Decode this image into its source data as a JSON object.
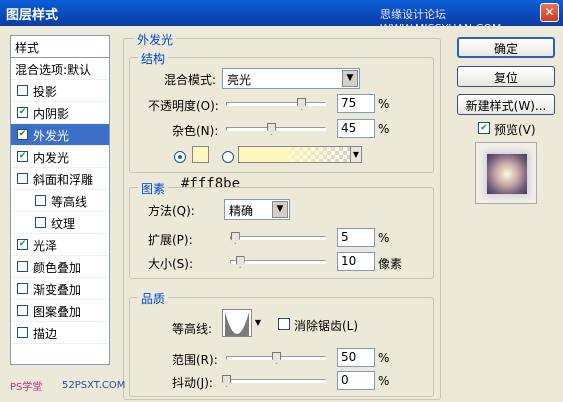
{
  "window": {
    "title": "图层样式",
    "watermark": "思缘设计论坛 WWW.MISSYUAN.COM",
    "close_icon": "close-icon"
  },
  "styles_list": {
    "header": "样式",
    "blend_label": "混合选项:默认",
    "items": [
      {
        "label": "投影",
        "checked": false
      },
      {
        "label": "内阴影",
        "checked": true
      },
      {
        "label": "外发光",
        "checked": true,
        "selected": true
      },
      {
        "label": "内发光",
        "checked": true
      },
      {
        "label": "斜面和浮雕",
        "checked": false
      },
      {
        "label": "等高线",
        "checked": false,
        "indent": true
      },
      {
        "label": "纹理",
        "checked": false,
        "indent": true
      },
      {
        "label": "光泽",
        "checked": true
      },
      {
        "label": "颜色叠加",
        "checked": false
      },
      {
        "label": "渐变叠加",
        "checked": false
      },
      {
        "label": "图案叠加",
        "checked": false
      },
      {
        "label": "描边",
        "checked": false
      }
    ]
  },
  "panel": {
    "title": "外发光",
    "structure": {
      "title": "结构",
      "blend_mode_label": "混合模式:",
      "blend_mode_value": "亮光",
      "opacity_label": "不透明度(O):",
      "opacity_value": "75",
      "noise_label": "杂色(N):",
      "noise_value": "45",
      "percent": "%",
      "glow_color": "#fff8be"
    },
    "elements": {
      "title": "图素",
      "color_code": "#fff8be",
      "technique_label": "方法(Q):",
      "technique_value": "精确",
      "spread_label": "扩展(P):",
      "spread_value": "5",
      "size_label": "大小(S):",
      "size_value": "10",
      "percent": "%",
      "pixels": "像素"
    },
    "quality": {
      "title": "品质",
      "contour_label": "等高线:",
      "antialias_label": "消除锯齿(L)",
      "range_label": "范围(R):",
      "range_value": "50",
      "jitter_label": "抖动(J):",
      "jitter_value": "0",
      "percent": "%"
    }
  },
  "buttons": {
    "ok": "确定",
    "reset": "复位",
    "new_style": "新建样式(W)...",
    "preview_label": "预览(V)"
  },
  "footer": {
    "logo": "PS学堂",
    "site": "52PSXT.COM"
  }
}
